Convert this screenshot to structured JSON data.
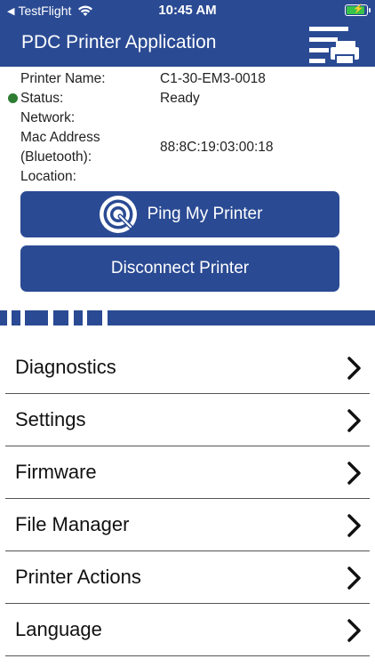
{
  "status_bar": {
    "back_app": "TestFlight",
    "time": "10:45 AM",
    "battery_color": "#36c24b"
  },
  "header": {
    "title": "PDC Printer Application",
    "menu_icon": "printer-list-icon",
    "background": "#2a4a93"
  },
  "printer_info": {
    "name_label": "Printer Name:",
    "name_value": "C1-30-EM3-0018",
    "status_label": "Status:",
    "status_value": "Ready",
    "status_color": "#2e7d32",
    "network_label": "Network:",
    "network_value": "",
    "mac_label_line1": "Mac Address",
    "mac_label_line2": "(Bluetooth):",
    "mac_value": "88:8C:19:03:00:18",
    "location_label": "Location:",
    "location_value": ""
  },
  "actions": {
    "ping_label": "Ping My Printer",
    "ping_icon": "ping-q-icon",
    "disconnect_label": "Disconnect Printer"
  },
  "menu": {
    "items": [
      {
        "label": "Diagnostics"
      },
      {
        "label": "Settings"
      },
      {
        "label": "Firmware"
      },
      {
        "label": "File Manager"
      },
      {
        "label": "Printer Actions"
      },
      {
        "label": "Language"
      }
    ],
    "chevron_icon": "chevron-right-icon"
  }
}
